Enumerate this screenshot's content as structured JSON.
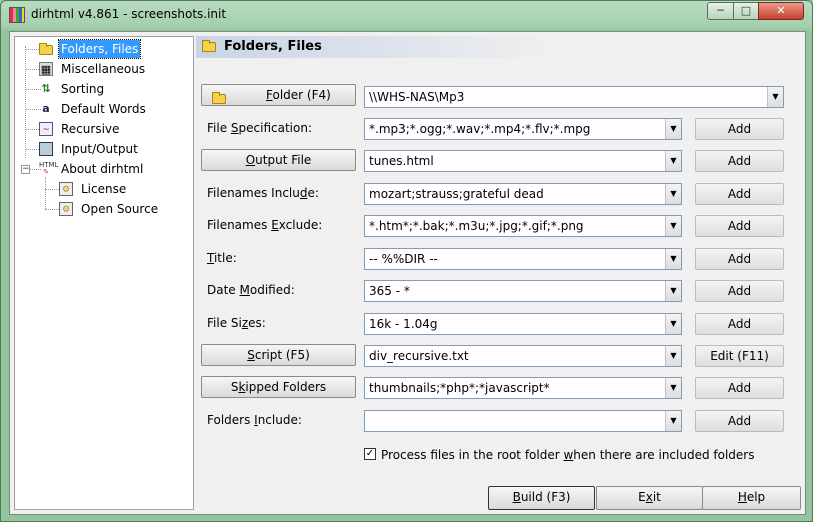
{
  "window": {
    "title": "dirhtml v4.861 - screenshots.init",
    "controls": {
      "minimize": "─",
      "maximize": "□",
      "close": "✕"
    }
  },
  "tree": {
    "items": [
      {
        "label": "Folders, Files",
        "icon": "folder-icon",
        "selected": true
      },
      {
        "label": "Miscellaneous",
        "icon": "misc-icon"
      },
      {
        "label": "Sorting",
        "icon": "sort-icon"
      },
      {
        "label": "Default Words",
        "icon": "words-icon"
      },
      {
        "label": "Recursive",
        "icon": "recursive-icon"
      },
      {
        "label": "Input/Output",
        "icon": "io-icon"
      },
      {
        "label": "About dirhtml",
        "icon": "html-icon",
        "expanded": true
      },
      {
        "label": "License",
        "icon": "license-icon"
      },
      {
        "label": "Open Source",
        "icon": "opensource-icon"
      }
    ]
  },
  "panel": {
    "title": "Folders, Files"
  },
  "form": {
    "folder": {
      "btn_pre": "",
      "btn_u": "F",
      "btn_post": "older (F4)",
      "value": "\\\\WHS-NAS\\Mp3"
    },
    "file_spec": {
      "pre": "File ",
      "u": "S",
      "post": "pecification:",
      "value": "*.mp3;*.ogg;*.wav;*.mp4;*.flv;*.mpg",
      "add": "Add"
    },
    "output_file": {
      "pre": "",
      "u": "O",
      "post": "utput File",
      "value": "tunes.html",
      "add": "Add"
    },
    "include": {
      "pre": "Filenames Inclu",
      "u": "d",
      "post": "e:",
      "value": "mozart;strauss;grateful dead",
      "add": "Add"
    },
    "exclude": {
      "pre": "Filenames ",
      "u": "E",
      "post": "xclude:",
      "value": "*.htm*;*.bak;*.m3u;*.jpg;*.gif;*.png",
      "add": "Add"
    },
    "title": {
      "pre": "",
      "u": "T",
      "post": "itle:",
      "value": "-- %%DIR --",
      "add": "Add"
    },
    "date_modified": {
      "pre": "Date ",
      "u": "M",
      "post": "odified:",
      "value": "365 - *",
      "add": "Add"
    },
    "file_sizes": {
      "pre": "File Si",
      "u": "z",
      "post": "es:",
      "value": "16k - 1.04g",
      "add": "Add"
    },
    "script": {
      "pre": "",
      "u": "S",
      "post": "cript (F5)",
      "value": "div_recursive.txt",
      "add": "Edit (F11)"
    },
    "skipped": {
      "pre": "S",
      "u": "k",
      "post": "ipped Folders",
      "value": "thumbnails;*php*;*javascript*",
      "add": "Add"
    },
    "folders_include": {
      "pre": "Folders ",
      "u": "I",
      "post": "nclude:",
      "value": "",
      "add": "Add"
    },
    "process_root": {
      "checked": true,
      "pre": "Process files in the root folder ",
      "u": "w",
      "post": "hen there are included folders"
    }
  },
  "buttons": {
    "build": {
      "pre": "",
      "u": "B",
      "post": "uild (F3)"
    },
    "exit": {
      "pre": "E",
      "u": "x",
      "post": "it"
    },
    "help": {
      "pre": "",
      "u": "H",
      "post": "elp"
    }
  }
}
